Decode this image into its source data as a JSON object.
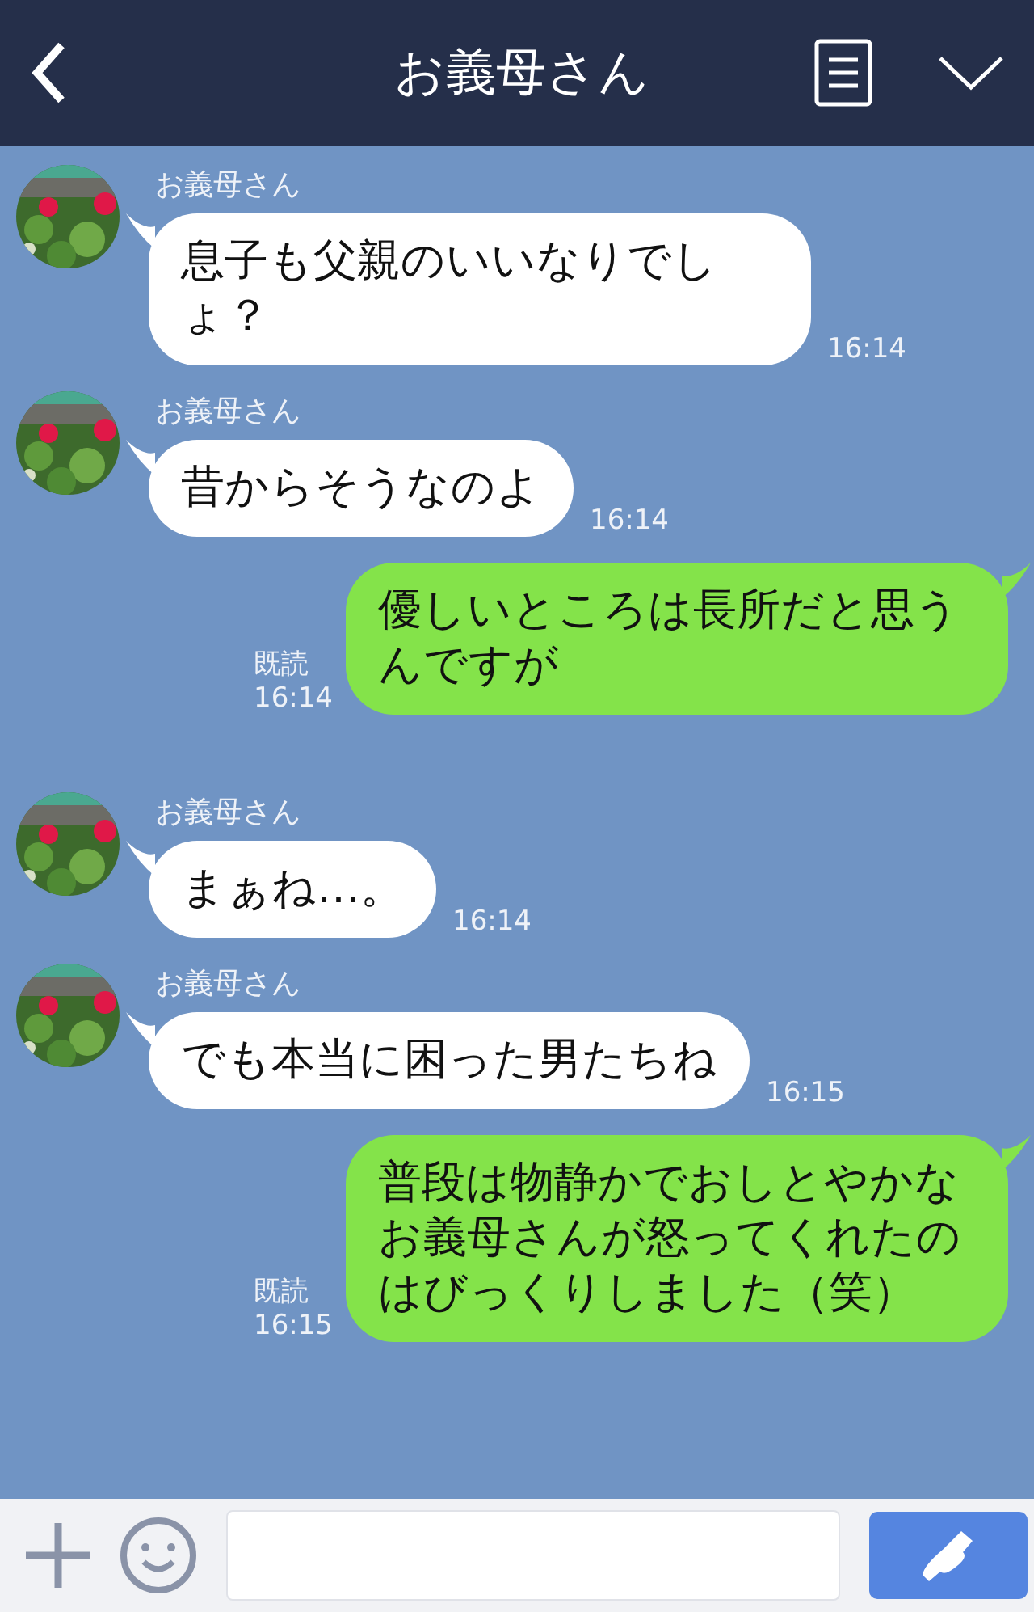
{
  "header": {
    "title": "お義母さん"
  },
  "messages": [
    {
      "kind": "incoming",
      "sender": "お義母さん",
      "text": "息子も父親のいいなりでしょ？",
      "time": "16:14"
    },
    {
      "kind": "incoming",
      "sender": "お義母さん",
      "text": "昔からそうなのよ",
      "time": "16:14"
    },
    {
      "kind": "outgoing",
      "read": "既読",
      "time": "16:14",
      "text": "優しいところは長所だと思うんですが"
    },
    {
      "kind": "incoming",
      "sender": "お義母さん",
      "text": "まぁね…。",
      "time": "16:14"
    },
    {
      "kind": "incoming",
      "sender": "お義母さん",
      "text": "でも本当に困った男たちね",
      "time": "16:15"
    },
    {
      "kind": "outgoing",
      "read": "既読",
      "time": "16:15",
      "text": "普段は物静かでおしとやかなお義母さんが怒ってくれたのはびっくりしました（笑）"
    }
  ]
}
